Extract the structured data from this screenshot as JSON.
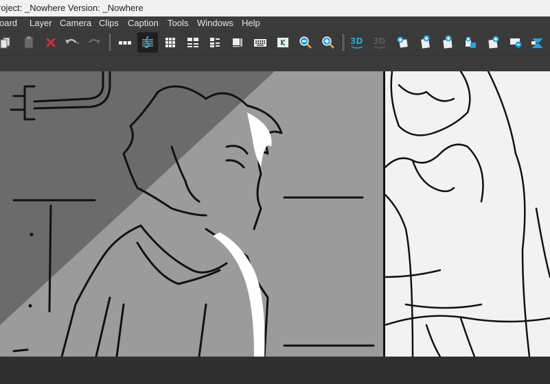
{
  "window": {
    "title": "roject: _Nowhere Version: _Nowhere"
  },
  "menu": {
    "items": [
      "oard",
      "Layer",
      "Camera",
      "Clips",
      "Caption",
      "Tools",
      "Windows",
      "Help"
    ]
  },
  "toolbar": {
    "buttons": [
      {
        "name": "copy-icon"
      },
      {
        "name": "paste-icon"
      },
      {
        "name": "delete-icon"
      },
      {
        "name": "undo-icon"
      },
      {
        "name": "redo-icon"
      },
      {
        "name": "separator"
      },
      {
        "name": "strip-view-icon"
      },
      {
        "name": "sound-clef-icon",
        "active": true
      },
      {
        "name": "grid-view-icon"
      },
      {
        "name": "thumbnails-view-icon"
      },
      {
        "name": "list-view-icon"
      },
      {
        "name": "panel-view-icon"
      },
      {
        "name": "keyboard-icon"
      },
      {
        "name": "storyboard-k-icon"
      },
      {
        "name": "zoom-out-icon"
      },
      {
        "name": "zoom-in-icon"
      },
      {
        "name": "separator"
      },
      {
        "name": "3d-icon",
        "label": "3D"
      },
      {
        "name": "3d-disabled-icon",
        "label": "3D"
      },
      {
        "name": "add-panel-icon"
      },
      {
        "name": "duplicate-panel-icon"
      },
      {
        "name": "new-panel-icon"
      },
      {
        "name": "split-panel-icon"
      },
      {
        "name": "import-panel-icon"
      },
      {
        "name": "camera-panel-icon"
      },
      {
        "name": "transition-icon"
      }
    ]
  },
  "colors": {
    "titlebar_bg": "#f1f1f1",
    "menubar_bg": "#3c3c3c",
    "toolbar_bg": "#3a3a3a",
    "accent_blue": "#27a4dc",
    "delete_red": "#d0312d",
    "stage_gray": "#999999",
    "shadow_gray": "#6a6a6a"
  }
}
